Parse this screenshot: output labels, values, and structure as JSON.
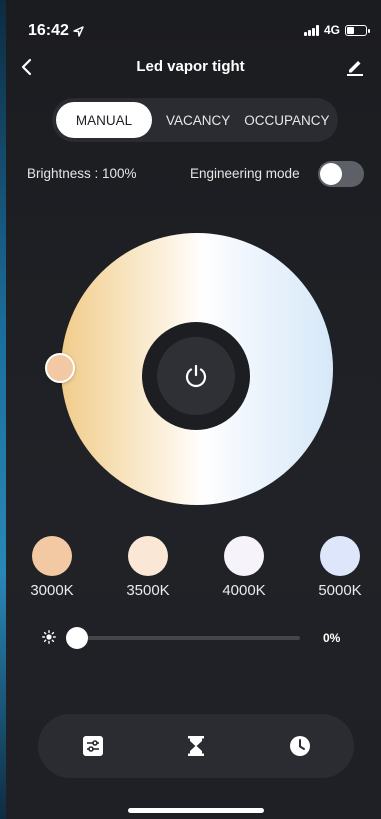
{
  "status_bar": {
    "time": "16:42",
    "network": "4G"
  },
  "header": {
    "title": "Led vapor tight",
    "back_icon": "chevron-left-icon",
    "edit_icon": "pencil-icon"
  },
  "mode_tabs": [
    {
      "label": "MANUAL",
      "active": true
    },
    {
      "label": "VACANCY",
      "active": false
    },
    {
      "label": "OCCUPANCY",
      "active": false
    }
  ],
  "brightness": {
    "label": "Brightness : 100%"
  },
  "engineering_mode": {
    "label": "Engineering mode",
    "enabled": false
  },
  "color_wheel": {
    "center_icon": "power-icon",
    "warm_color": "#f1cc8a",
    "cool_color": "#d6e8f8",
    "handle_color": "#f3c9a3"
  },
  "presets": [
    {
      "label": "3000K",
      "color": "#f3c9a3"
    },
    {
      "label": "3500K",
      "color": "#fbe7d6"
    },
    {
      "label": "4000K",
      "color": "#f7f3fb"
    },
    {
      "label": "5000K",
      "color": "#dde6fb"
    }
  ],
  "slider": {
    "icon": "sun-icon",
    "value_text": "0%",
    "value": 0
  },
  "bottom_nav": [
    {
      "icon": "sliders-icon"
    },
    {
      "icon": "hourglass-icon"
    },
    {
      "icon": "clock-icon"
    }
  ]
}
